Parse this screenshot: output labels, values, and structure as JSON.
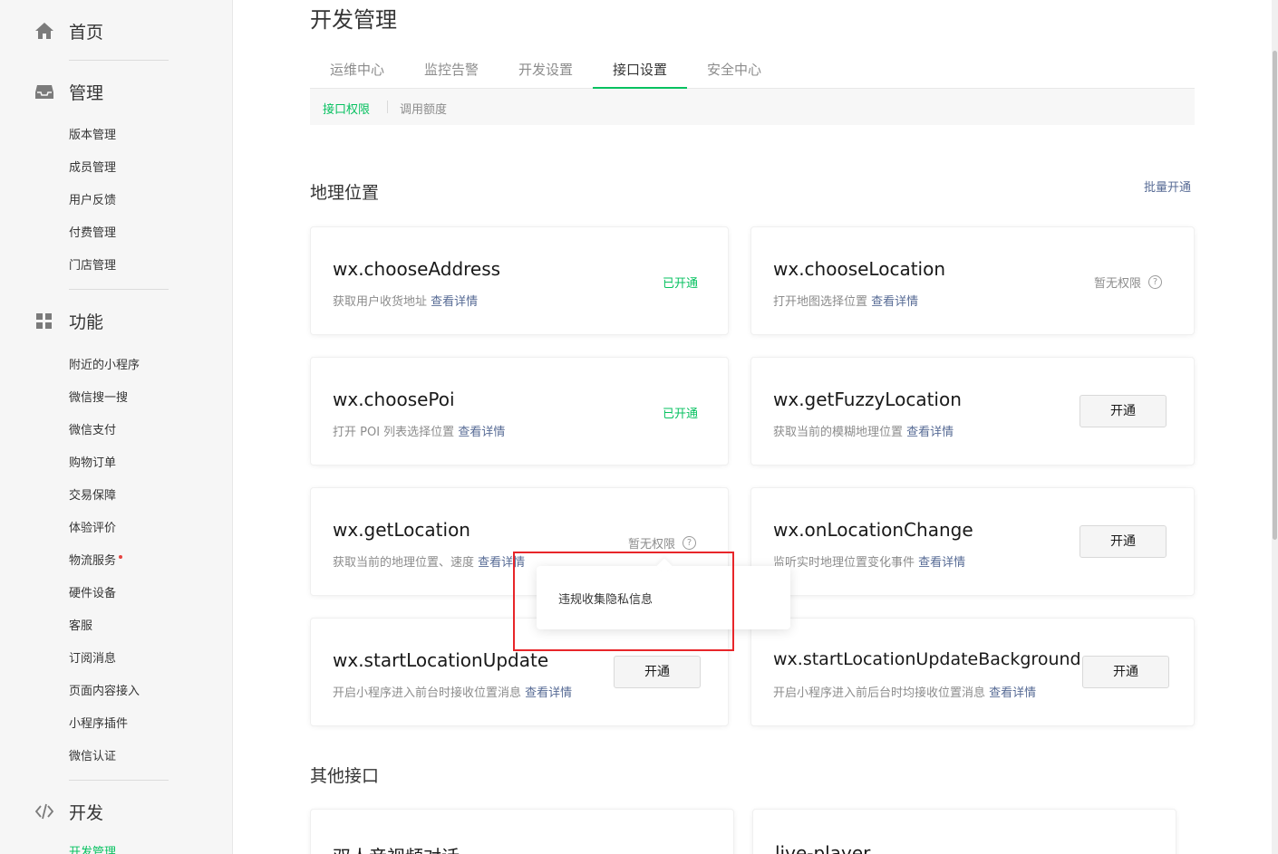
{
  "sidebar": {
    "home": {
      "label": "首页",
      "icon": "home-icon"
    },
    "manage": {
      "label": "管理",
      "icon": "inbox-icon",
      "items": [
        "版本管理",
        "成员管理",
        "用户反馈",
        "付费管理",
        "门店管理"
      ]
    },
    "features": {
      "label": "功能",
      "icon": "grid-icon",
      "items": [
        "附近的小程序",
        "微信搜一搜",
        "微信支付",
        "购物订单",
        "交易保障",
        "体验评价",
        "物流服务",
        "硬件设备",
        "客服",
        "订阅消息",
        "页面内容接入",
        "小程序插件",
        "微信认证"
      ]
    },
    "dev": {
      "label": "开发",
      "icon": "code-icon",
      "items": [
        "开发管理"
      ]
    }
  },
  "main": {
    "title": "开发管理",
    "tabs": [
      "运维中心",
      "监控告警",
      "开发设置",
      "接口设置",
      "安全中心"
    ],
    "active_tab": "接口设置",
    "subtabs": [
      "接口权限",
      "调用额度"
    ],
    "active_subtab": "接口权限"
  },
  "section_location": {
    "title": "地理位置",
    "batch_label": "批量开通",
    "cards": [
      {
        "name": "wx.chooseAddress",
        "desc": "获取用户收货地址",
        "link": "查看详情",
        "status": "已开通"
      },
      {
        "name": "wx.chooseLocation",
        "desc": "打开地图选择位置",
        "link": "查看详情",
        "status": "暂无权限"
      },
      {
        "name": "wx.choosePoi",
        "desc": "打开 POI 列表选择位置",
        "link": "查看详情",
        "status": "已开通"
      },
      {
        "name": "wx.getFuzzyLocation",
        "desc": "获取当前的模糊地理位置",
        "link": "查看详情",
        "status": "开通"
      },
      {
        "name": "wx.getLocation",
        "desc": "获取当前的地理位置、速度",
        "link": "查看详情",
        "status": "暂无权限"
      },
      {
        "name": "wx.onLocationChange",
        "desc": "监听实时地理位置变化事件",
        "link": "查看详情",
        "status": "开通"
      },
      {
        "name": "wx.startLocationUpdate",
        "desc": "开启小程序进入前台时接收位置消息",
        "link": "查看详情",
        "status": "开通"
      },
      {
        "name": "wx.startLocationUpdateBackground",
        "desc": "开启小程序进入前后台时均接收位置消息",
        "link": "查看详情",
        "status": "开通"
      }
    ]
  },
  "tooltip": {
    "text": "违规收集隐私信息"
  },
  "section_other": {
    "title": "其他接口",
    "cards": [
      {
        "name": "双人音视频对话"
      },
      {
        "name": "live-player"
      }
    ]
  },
  "colors": {
    "accent": "#07c160",
    "link": "#576b95",
    "highlight": "#e8262a"
  }
}
